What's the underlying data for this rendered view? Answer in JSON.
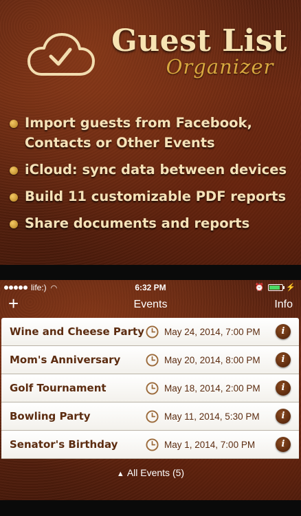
{
  "promo": {
    "title": "Guest List",
    "subtitle": "Organizer",
    "features": [
      "Import guests from Facebook,\nContacts or Other Events",
      "iCloud: sync data between devices",
      "Build 11 customizable PDF reports",
      "Share documents and reports"
    ]
  },
  "status_bar": {
    "carrier": "life:)",
    "time": "6:32 PM"
  },
  "navbar": {
    "add_label": "+",
    "title": "Events",
    "info_label": "Info"
  },
  "events": [
    {
      "name": "Wine and Cheese Party",
      "date": "May 24, 2014, 7:00 PM"
    },
    {
      "name": "Mom's Anniversary",
      "date": "May 20, 2014, 8:00 PM"
    },
    {
      "name": "Golf Tournament",
      "date": "May 18, 2014, 2:00 PM"
    },
    {
      "name": "Bowling Party",
      "date": "May 11, 2014, 5:30 PM"
    },
    {
      "name": "Senator's Birthday",
      "date": "May 1, 2014, 7:00 PM"
    }
  ],
  "filter": {
    "label": "All Events (5)"
  },
  "colors": {
    "accent_gold": "#d9a83f",
    "text_brown": "#5c2c10"
  },
  "icons": [
    "cloud-check-icon",
    "wifi-icon",
    "alarm-icon",
    "battery-icon",
    "clock-icon",
    "info-icon",
    "triangle-up-icon"
  ]
}
